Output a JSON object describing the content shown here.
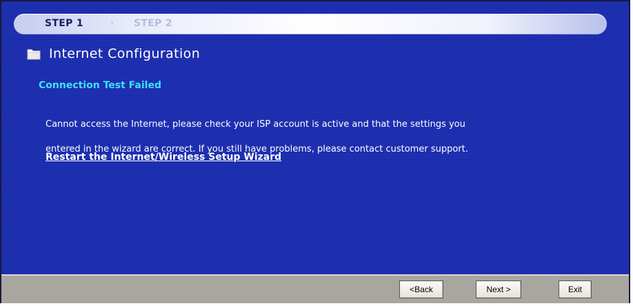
{
  "steps": {
    "step1_label": "STEP 1",
    "separator": "›",
    "step2_label": "STEP 2"
  },
  "page": {
    "title": "Internet Configuration",
    "icon": "folder-icon"
  },
  "content": {
    "heading": "Connection Test Failed",
    "message_line1": "Cannot access the Internet, please check your ISP account is active and that the settings you",
    "message_line2": "entered in the wizard are correct. If you still have problems, please contact customer support.",
    "restart_link": "Restart the Internet/Wireless Setup Wizard"
  },
  "footer": {
    "back_label": "<Back",
    "next_label": "Next >",
    "exit_label": "Exit"
  },
  "colors": {
    "panel_blue": "#1b2cab",
    "heading_cyan": "#3ee0ff",
    "footer_gray": "#a9a6a0"
  }
}
